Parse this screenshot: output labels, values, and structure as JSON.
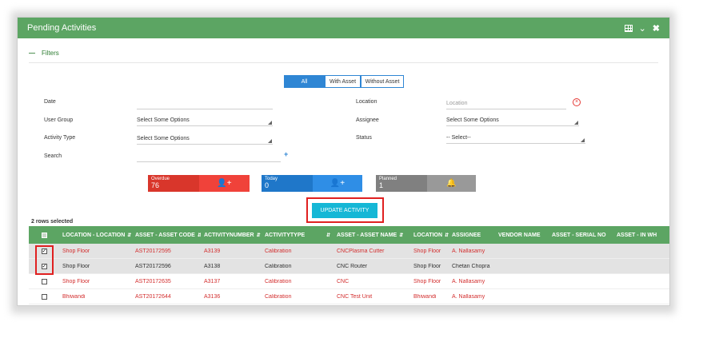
{
  "window": {
    "title": "Pending Activities"
  },
  "filters": {
    "toggle_label": "Filters",
    "scope_tabs": [
      {
        "label": "All",
        "active": true
      },
      {
        "label": "With Asset",
        "active": false
      },
      {
        "label": "Without Asset",
        "active": false
      }
    ],
    "date": {
      "label": "Date",
      "value": ""
    },
    "location": {
      "label": "Location",
      "placeholder": "Location"
    },
    "user_group": {
      "label": "User Group",
      "value": "Select Some Options"
    },
    "assignee": {
      "label": "Assignee",
      "value": "Select Some Options"
    },
    "activity_type": {
      "label": "Activity Type",
      "value": "Select Some Options"
    },
    "status": {
      "label": "Status",
      "value": "-- Select--"
    },
    "search": {
      "label": "Search",
      "value": ""
    }
  },
  "summary_cards": [
    {
      "label": "Overdue",
      "count": "76",
      "color": "#d9362b",
      "icon": "add-user-icon"
    },
    {
      "label": "Today",
      "count": "0",
      "color": "#2f86d4",
      "icon": "add-user-icon"
    },
    {
      "label": "Planned",
      "count": "1",
      "color": "#8a8a8a",
      "icon": "bell-icon"
    }
  ],
  "update_button": {
    "label": "UPDATE ACTIVITY"
  },
  "selection_status": "2 rows selected",
  "table": {
    "columns": [
      "LOCATION - LOCATION",
      "ASSET - ASSET CODE",
      "ACTIVITYNUMBER",
      "ACTIVITYTYPE",
      "ASSET - ASSET NAME",
      "LOCATION",
      "ASSIGNEE",
      "VENDOR NAME",
      "ASSET - SERIAL NO",
      "ASSET - IN WH"
    ],
    "rows": [
      {
        "checked": true,
        "cells": [
          "Shop Floor",
          "AST20172595",
          "A3139",
          "Calibration",
          "CNCPlasma Cutter",
          "Shop Floor",
          "A. Nallasamy",
          "",
          "",
          ""
        ]
      },
      {
        "checked": true,
        "cells": [
          "Shop Floor",
          "AST20172596",
          "A3138",
          "Calibration",
          "CNC Router",
          "Shop Floor",
          "Chetan Chopra",
          "",
          "",
          ""
        ]
      },
      {
        "checked": false,
        "cells": [
          "Shop Floor",
          "AST20172635",
          "A3137",
          "Calibration",
          "CNC",
          "Shop Floor",
          "A. Nallasamy",
          "",
          "",
          ""
        ]
      },
      {
        "checked": false,
        "cells": [
          "Bhiwandi",
          "AST20172644",
          "A3136",
          "Calibration",
          "CNC Test Unit",
          "Bhiwandi",
          "A. Nallasamy",
          "",
          "",
          ""
        ]
      }
    ]
  },
  "colors": {
    "header_green": "#5ca563",
    "accent_blue": "#2f86d4",
    "highlight_red": "#e02020"
  }
}
